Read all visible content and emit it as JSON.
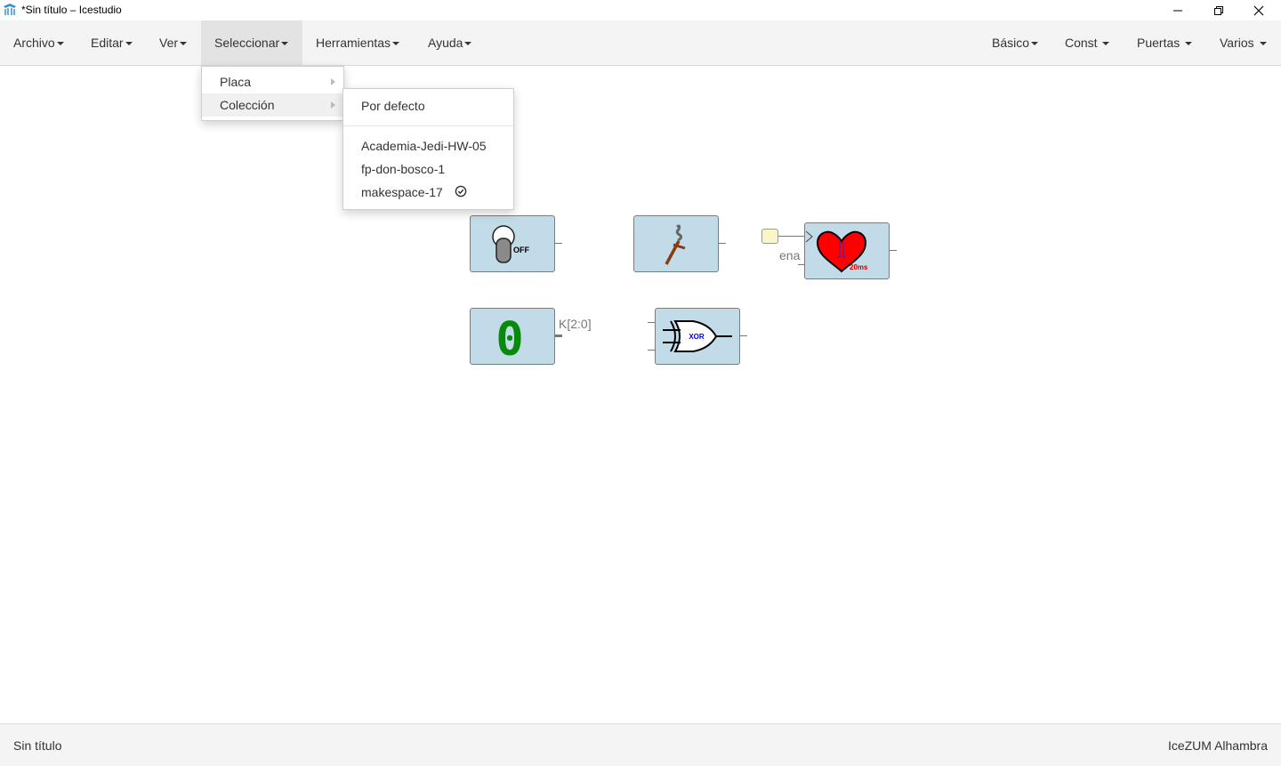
{
  "window": {
    "title": "*Sin título – Icestudio"
  },
  "menubar": {
    "left": [
      "Archivo",
      "Editar",
      "Ver",
      "Seleccionar",
      "Herramientas",
      "Ayuda"
    ],
    "right": [
      "Básico",
      "Const",
      "Puertas",
      "Varios"
    ],
    "active": "Seleccionar"
  },
  "seleccionar_menu": {
    "items": [
      "Placa",
      "Colección"
    ],
    "hovered": "Colección"
  },
  "coleccion_submenu": {
    "default": "Por defecto",
    "collections": [
      "Academia-Jedi-HW-05",
      "fp-don-bosco-1",
      "makespace-17"
    ],
    "selected": "makespace-17"
  },
  "canvas": {
    "switch_block": {
      "icon": "toggle-switch-icon",
      "text": "OFF"
    },
    "lever_block": {
      "icon": "lever-icon"
    },
    "heartbeat_block": {
      "icon": "heart-icon",
      "text": "20ms",
      "port_label": "ena"
    },
    "constant_block": {
      "value": "0",
      "port_label": "K[2:0]"
    },
    "xor_block": {
      "icon": "xor-gate-icon",
      "text": "XOR"
    }
  },
  "statusbar": {
    "left": "Sin título",
    "right": "IceZUM Alhambra"
  },
  "colors": {
    "block_fill": "#c1dce8",
    "heart": "#ff0000",
    "constant_green": "#0a8a0a",
    "xor_text": "#0000cc"
  }
}
